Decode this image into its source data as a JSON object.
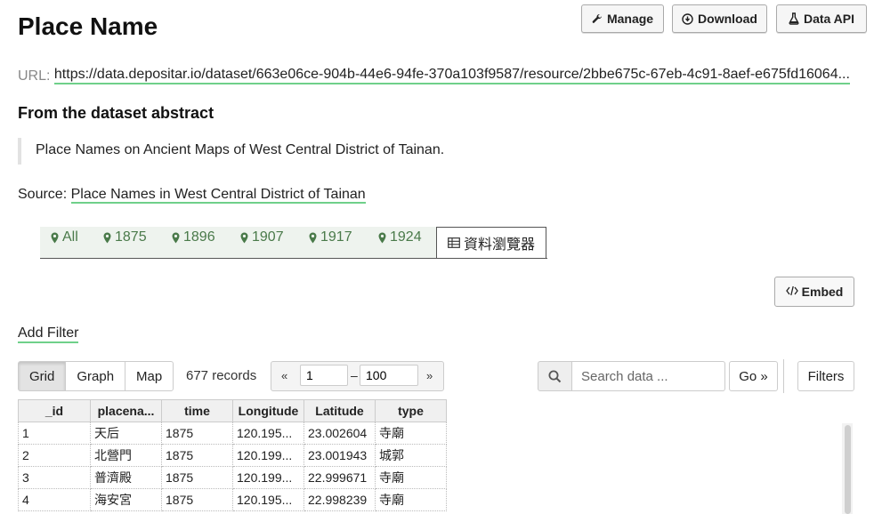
{
  "page": {
    "title": "Place Name",
    "url_label": "URL:",
    "url": "https://data.depositar.io/dataset/663e06ce-904b-44e6-94fe-370a103f9587/resource/2bbe675c-67eb-4c91-8aef-e675fd16064...",
    "abstract_heading": "From the dataset abstract",
    "abstract_text": "Place Names on Ancient Maps of West Central District of Tainan.",
    "source_label": "Source:",
    "source_link": "Place Names in West Central District of Tainan"
  },
  "actions": {
    "manage": "Manage",
    "download": "Download",
    "data_api": "Data API",
    "embed": "Embed"
  },
  "views": {
    "tabs": [
      "All",
      "1875",
      "1896",
      "1907",
      "1917",
      "1924"
    ],
    "active": "資料瀏覽器"
  },
  "explorer": {
    "add_filter": "Add Filter",
    "view_buttons": [
      "Grid",
      "Graph",
      "Map"
    ],
    "records": "677 records",
    "pager_prev": "«",
    "pager_next": "»",
    "page_from": "1",
    "page_dash": "–",
    "page_to": "100",
    "search_placeholder": "Search data ...",
    "go": "Go »",
    "filters": "Filters"
  },
  "table": {
    "headers": [
      "_id",
      "placena...",
      "time",
      "Longitude",
      "Latitude",
      "type"
    ],
    "rows": [
      [
        "1",
        "天后",
        "1875",
        "120.195...",
        "23.002604",
        "寺廟"
      ],
      [
        "2",
        "北營門",
        "1875",
        "120.199...",
        "23.001943",
        "城郭"
      ],
      [
        "3",
        "普濟殿",
        "1875",
        "120.199...",
        "22.999671",
        "寺廟"
      ],
      [
        "4",
        "海安宮",
        "1875",
        "120.195...",
        "22.998239",
        "寺廟"
      ]
    ]
  },
  "colors": {
    "link_underline": "#6fd08a",
    "tab_green": "#4a7a4a"
  }
}
